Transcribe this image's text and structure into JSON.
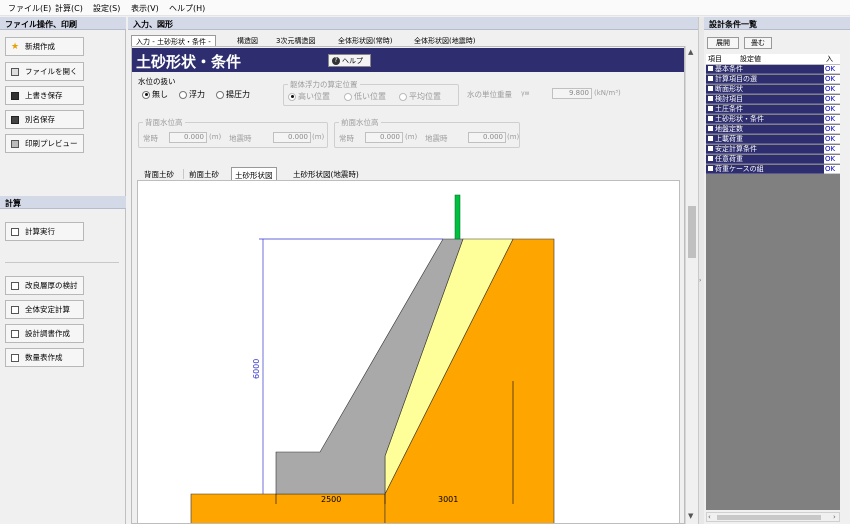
{
  "menu": [
    "ファイル(E)",
    "計算(C)",
    "設定(S)",
    "表示(V)",
    "ヘルプ(H)"
  ],
  "left": {
    "file_title": "ファイル操作、印刷",
    "file_buttons": [
      "新規作成",
      "ファイルを開く",
      "上書き保存",
      "別名保存",
      "印刷プレビュー"
    ],
    "calc_title": "計算",
    "calc_button": "計算実行",
    "other_buttons": [
      "改良層厚の検討",
      "全体安定計算",
      "設計調書作成",
      "数量表作成"
    ]
  },
  "center": {
    "title": "入力、図形",
    "tabs": [
      "入力 - 土砂形状・条件 -",
      "構造図",
      "3次元構造図",
      "全体形状図(常時)",
      "全体形状図(地震時)"
    ],
    "heading": "土砂形状・条件",
    "help_label": "ヘルプ",
    "water": {
      "legend": "水位の扱い",
      "options": [
        "無し",
        "浮力",
        "揚圧力"
      ],
      "selected": 0
    },
    "buoyancy": {
      "legend": "躯体浮力の算定位置",
      "options": [
        "高い位置",
        "低い位置",
        "平均位置"
      ],
      "selected": 0
    },
    "unit_weight": {
      "label": "水の単位重量",
      "symbol": "γw",
      "value": "9.800",
      "unit": "(kN/m³)"
    },
    "back_water": {
      "legend": "背面水位高",
      "normal_label": "常時",
      "normal_value": "0.000",
      "quake_label": "地震時",
      "quake_value": "0.000",
      "unit": "(m)"
    },
    "front_water": {
      "legend": "前面水位高",
      "normal_label": "常時",
      "normal_value": "0.000",
      "quake_label": "地震時",
      "quake_value": "0.000",
      "unit": "(m)"
    },
    "subtabs": [
      "背面土砂",
      "前面土砂",
      "土砂形状図",
      "土砂形状図(地震時)"
    ],
    "drawing": {
      "height_dim": "6000",
      "base_dim": "2500",
      "slope_dim": "3001"
    }
  },
  "right": {
    "title": "設計条件一覧",
    "expand": "展開",
    "collapse": "畳む",
    "cols": [
      "項目",
      "設定値",
      "入"
    ],
    "items": [
      {
        "name": "基本条件",
        "status": "OK"
      },
      {
        "name": "計算項目の選",
        "status": "OK"
      },
      {
        "name": "断面形状",
        "status": "OK"
      },
      {
        "name": "検討項目",
        "status": "OK"
      },
      {
        "name": "土圧条件",
        "status": "OK"
      },
      {
        "name": "土砂形状・条件",
        "status": "OK"
      },
      {
        "name": "地盤定数",
        "status": "OK"
      },
      {
        "name": "上載荷重",
        "status": "OK"
      },
      {
        "name": "安定計算条件",
        "status": "OK"
      },
      {
        "name": "任意荷重",
        "status": "OK"
      },
      {
        "name": "荷重ケースの組",
        "status": "OK"
      }
    ]
  },
  "colors": {
    "panel_header": "#d4d9e8",
    "navy": "#2d2d6f",
    "ground": "#ffa500",
    "wall": "#a9a9a9",
    "fill": "#ffff99",
    "pole": "#00c040"
  }
}
